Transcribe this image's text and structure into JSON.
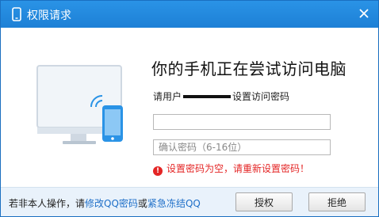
{
  "window": {
    "title": "权限请求"
  },
  "content": {
    "headline": "你的手机正在尝试访问电脑",
    "subline_prefix": "请用户",
    "subline_suffix": "设置访问密码"
  },
  "form": {
    "password_value": "",
    "confirm_placeholder": "确认密码（6-16位）",
    "error_text": "设置密码为空，请重新设置密码！"
  },
  "footer": {
    "prefix": "若非本人操作，请",
    "link_change_pwd": "修改QQ密码",
    "middle": "或",
    "link_freeze": "紧急冻结QQ",
    "authorize_label": "授权",
    "reject_label": "拒绝"
  },
  "icons": {
    "title": "phone-icon",
    "close": "close-icon",
    "error": "error-icon",
    "illustration": "monitor-phone-illustration"
  },
  "colors": {
    "titlebar": "#1d80d6",
    "link": "#1e6fc8",
    "error": "#e42525"
  }
}
